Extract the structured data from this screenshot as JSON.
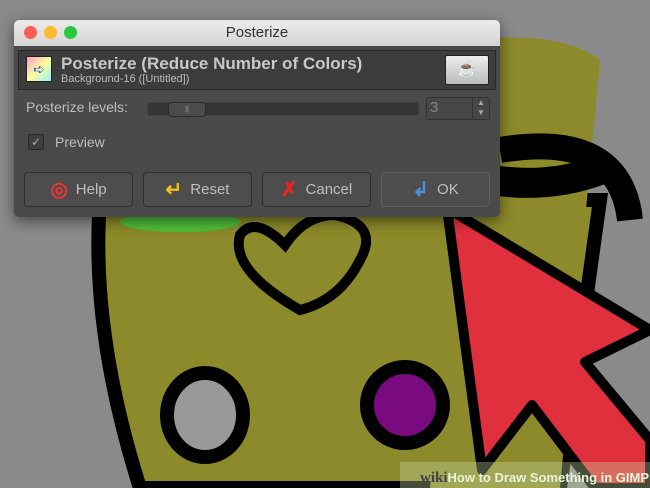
{
  "window": {
    "title": "Posterize"
  },
  "header": {
    "title": "Posterize (Reduce Number of Colors)",
    "subtitle": "Background-16 ([Untitled])"
  },
  "levels": {
    "label": "Posterize levels:",
    "value": "3",
    "slider_fraction": 0.01
  },
  "preview": {
    "label": "Preview",
    "checked": true
  },
  "buttons": {
    "help": "Help",
    "reset": "Reset",
    "cancel": "Cancel",
    "ok": "OK"
  },
  "watermark": {
    "brand": "wiki",
    "text": "How to Draw Something in GIMP"
  },
  "colors": {
    "olive": "#8c8a2a",
    "arrow": "#e0303e",
    "purple": "#7a0a80",
    "canvas": "#8a8a8a"
  }
}
